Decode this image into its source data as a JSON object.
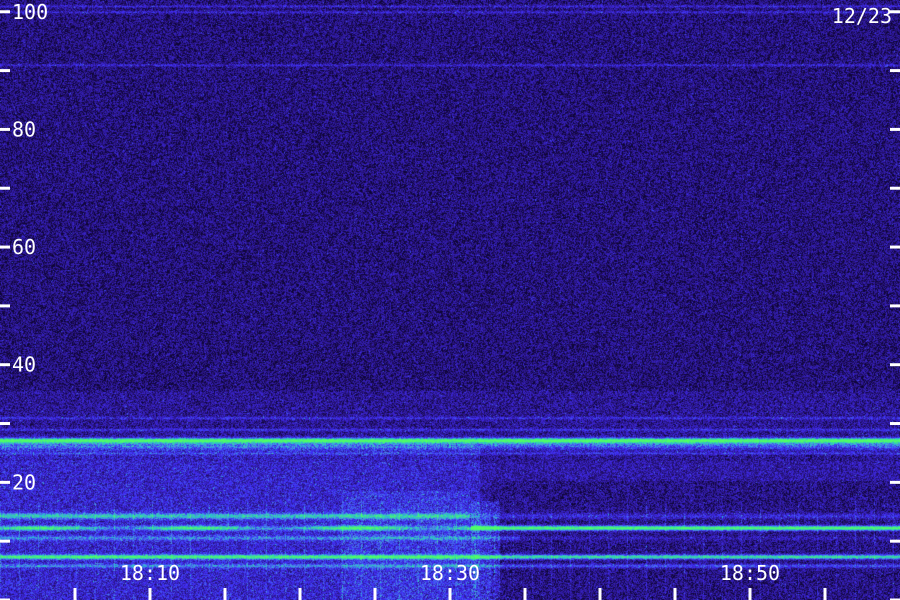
{
  "chart_data": {
    "type": "heatmap",
    "date_label": "12/23",
    "y_axis": {
      "ylim": [
        0,
        102
      ],
      "tick_labels": [
        "20",
        "40",
        "60",
        "80",
        "100"
      ],
      "tick_values": [
        20,
        40,
        60,
        80,
        100
      ],
      "minor_ticks": [
        0,
        10,
        30,
        50,
        70,
        90
      ]
    },
    "x_axis": {
      "tick_labels": [
        "18:10",
        "18:30",
        "18:50"
      ],
      "tick_values_minutes": [
        1090,
        1110,
        1130
      ],
      "xlim_minutes": [
        1080,
        1140
      ],
      "minor_tick_step_minutes": 5
    },
    "colors": {
      "background": "#1a0b55",
      "noise_dark": "#12052d",
      "noise_mid": "#2a18a6",
      "noise_bright": "#5638ff",
      "band_cyan": "#18d8ff",
      "band_green": "#43ff9b",
      "axis_text": "#ffffff"
    },
    "bands": [
      {
        "name": "upper band",
        "y": 27.2,
        "strength": 0.8
      },
      {
        "name": "lower band",
        "y": 12.3,
        "strength": 0.95
      },
      {
        "name": "floor band",
        "y": 7.4,
        "strength": 0.75
      }
    ]
  }
}
